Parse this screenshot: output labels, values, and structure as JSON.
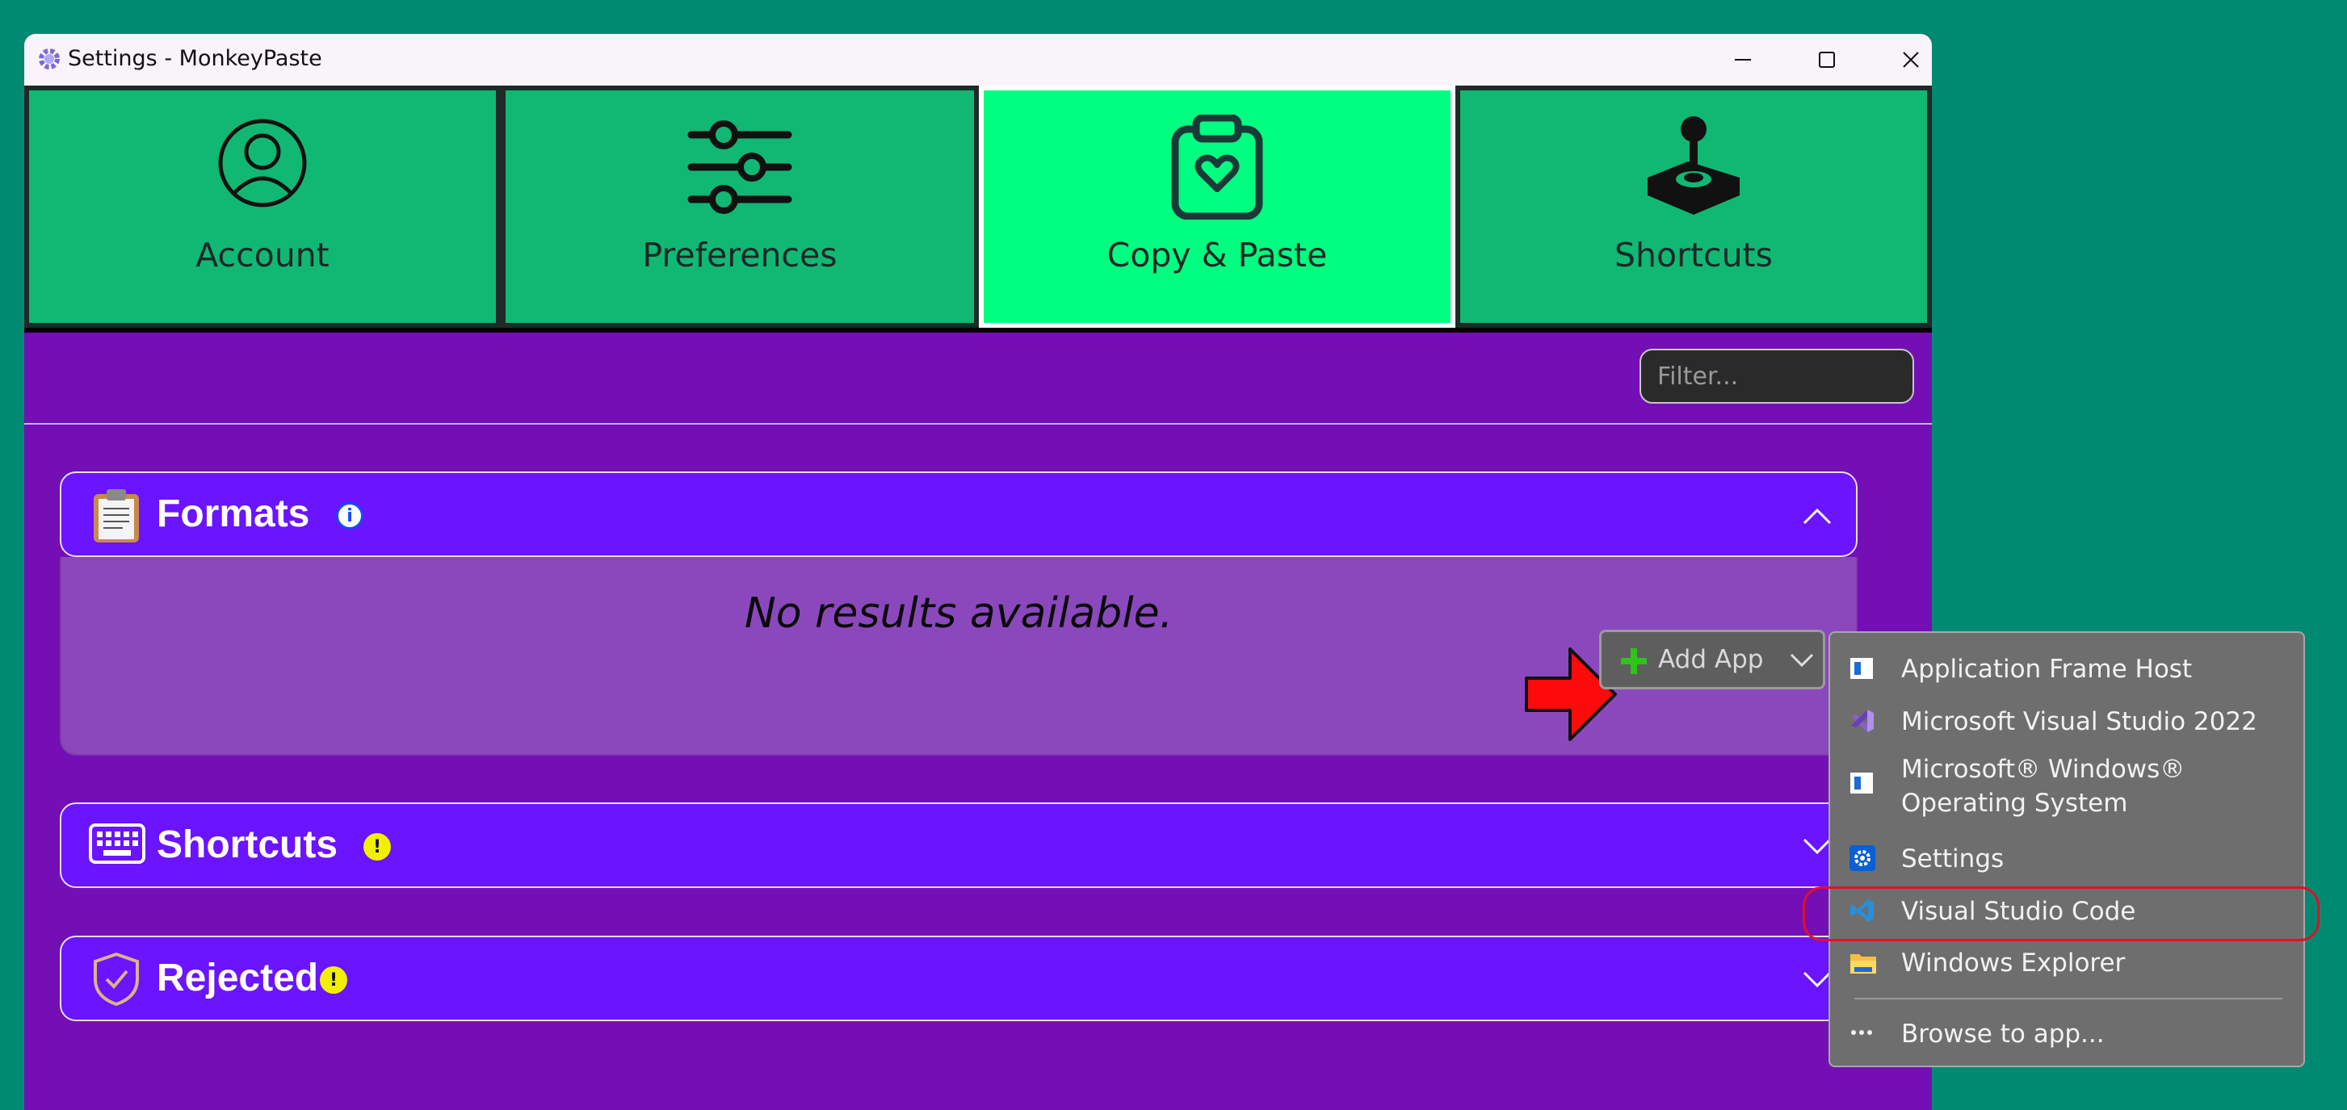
{
  "window": {
    "title": "Settings - MonkeyPaste"
  },
  "tabs": [
    {
      "label": "Account",
      "icon": "account-circle-icon",
      "active": false
    },
    {
      "label": "Preferences",
      "icon": "sliders-icon",
      "active": false
    },
    {
      "label": "Copy & Paste",
      "icon": "clipboard-heart-icon",
      "active": true
    },
    {
      "label": "Shortcuts",
      "icon": "joystick-icon",
      "active": false
    }
  ],
  "filter": {
    "placeholder": "Filter..."
  },
  "sections": {
    "formats": {
      "title": "Formats",
      "icon": "clipboard-icon",
      "badge": "i",
      "expanded": true,
      "empty_text": "No results available."
    },
    "shortcuts": {
      "title": "Shortcuts",
      "icon": "keyboard-icon",
      "badge": "!",
      "expanded": false
    },
    "rejected": {
      "title": "Rejected",
      "icon": "shield-check-icon",
      "badge": "!",
      "expanded": false
    }
  },
  "add_app": {
    "label": "Add App"
  },
  "app_menu": {
    "items": [
      {
        "label": "Application Frame Host",
        "icon": "app-frame-icon"
      },
      {
        "label": "Microsoft Visual Studio 2022",
        "icon": "visual-studio-icon"
      },
      {
        "label_line1": "Microsoft® Windows®",
        "label_line2": "Operating System",
        "icon": "windows-os-icon"
      },
      {
        "label": "Settings",
        "icon": "settings-gear-icon"
      },
      {
        "label": "Visual Studio Code",
        "icon": "vscode-icon",
        "highlighted": true
      },
      {
        "label": "Windows Explorer",
        "icon": "folder-icon"
      }
    ],
    "browse": {
      "label": "Browse to app...",
      "icon": "ellipsis-icon"
    }
  },
  "colors": {
    "desktop": "#008a72",
    "window_bg": "#730fb4",
    "tab_bg": "#10b874",
    "tab_active_bg": "#00ff80",
    "section_header": "#6a14ff",
    "section_body": "#8b48bd",
    "menu_bg": "#6e6e6e",
    "annotation_red": "#e0102a"
  }
}
